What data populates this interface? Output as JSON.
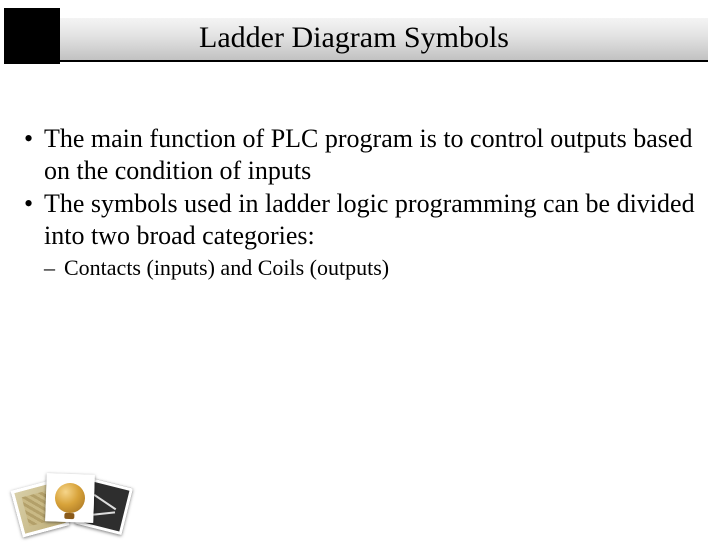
{
  "title": "Ladder Diagram Symbols",
  "bullets": [
    "The main function of PLC program is to control outputs based on the condition of inputs",
    "The symbols used in ladder logic programming can be divided into two broad categories:"
  ],
  "sub_bullet": "Contacts (inputs) and Coils (outputs)"
}
